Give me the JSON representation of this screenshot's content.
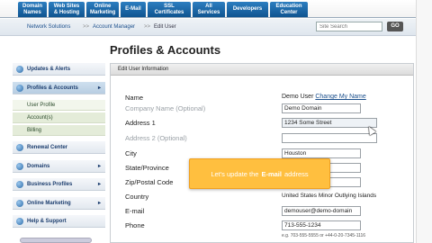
{
  "nav": {
    "tabs": [
      {
        "l1": "Domain",
        "l2": "Names"
      },
      {
        "l1": "Web Sites",
        "l2": "& Hosting"
      },
      {
        "l1": "Online",
        "l2": "Marketing"
      },
      {
        "l1": "E-Mail",
        "l2": ""
      },
      {
        "l1": "SSL",
        "l2": "Certificates"
      },
      {
        "l1": "All",
        "l2": "Services"
      },
      {
        "l1": "Developers",
        "l2": ""
      },
      {
        "l1": "Education",
        "l2": "Center"
      }
    ]
  },
  "breadcrumb": {
    "home": "Network Solutions",
    "sep1": ">>",
    "manager": "Account Manager",
    "sep2": ">>",
    "current": "Edit User"
  },
  "search": {
    "placeholder": "Site Search",
    "go_label": "GO"
  },
  "page": {
    "title": "Profiles & Accounts"
  },
  "sidebar": {
    "items": [
      {
        "label": "Updates & Alerts",
        "icon": "bell-icon"
      },
      {
        "label": "Profiles & Accounts",
        "icon": "user-icon",
        "arrow": "▸"
      },
      {
        "label": "Renewal Center",
        "icon": "refresh-icon"
      },
      {
        "label": "Domains",
        "icon": "globe-icon",
        "arrow": "▸"
      },
      {
        "label": "Business Profiles",
        "icon": "briefcase-icon",
        "arrow": "▸"
      },
      {
        "label": "Online Marketing",
        "icon": "chart-icon",
        "arrow": "▸"
      },
      {
        "label": "Help & Support",
        "icon": "help-icon"
      }
    ],
    "subitems": [
      "User Profile",
      "Account(s)",
      "Billing"
    ]
  },
  "form": {
    "header": "Edit User Information",
    "name_label": "Name",
    "name_value": "Demo User",
    "change_link": "Change My Name",
    "company_label": "Company Name (Optional)",
    "company_value": "Demo Domain",
    "address1_label": "Address 1",
    "address1_value": "1234 Some Street",
    "address2_label": "Address 2 (Optional)",
    "address2_value": "",
    "city_label": "City",
    "city_value": "Houston",
    "state_label": "State/Province",
    "zip_label": "Zip/Postal Code",
    "country_label": "Country",
    "country_value": "United States Minor Outlying Islands",
    "email_label": "E-mail",
    "email_value": "demouser@demo-domain",
    "phone_label": "Phone",
    "phone_value": "713-555-1234",
    "phone_hint": "e.g. 703-555-5555 or +44-0-20-7345-1116"
  },
  "tooltip": {
    "pre": "Let's update the",
    "bold": "E-mail",
    "post": "address"
  }
}
